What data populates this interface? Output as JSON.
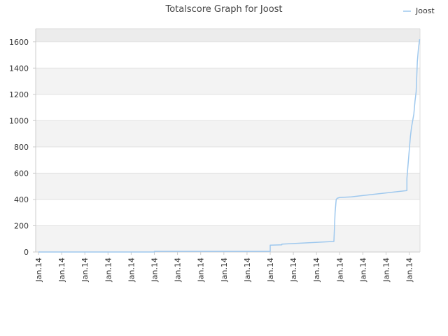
{
  "chart_data": {
    "type": "line",
    "title": "Totalscore Graph for Joost",
    "xlabel": "",
    "ylabel": "",
    "ylim": [
      0,
      1700
    ],
    "yticks": [
      0,
      200,
      400,
      600,
      800,
      1000,
      1200,
      1400,
      1600
    ],
    "xtick_labels": [
      "Jan.14",
      "Jan.14",
      "Jan.14",
      "Jan.14",
      "Jan.14",
      "Jan.14",
      "Jan.14",
      "Jan.14",
      "Jan.14",
      "Jan.14",
      "Jan.14",
      "Jan.14",
      "Jan.14",
      "Jan.14",
      "Jan.14",
      "Jan.14",
      "Jan.14"
    ],
    "legend": {
      "position": "top-right",
      "entries": [
        "Joost"
      ]
    },
    "grid": true,
    "colors": {
      "line": "#9ec8ee",
      "band": "#f3f3f3",
      "grid": "#e2e2e2",
      "axis": "#cccccc"
    },
    "series": [
      {
        "name": "Joost",
        "x": [
          0,
          5.0,
          5.0,
          10.0,
          10.0,
          10.5,
          10.5,
          12.7,
          12.75,
          12.8,
          12.85,
          12.9,
          13.0,
          13.5,
          15.9,
          15.9,
          16.05,
          16.1,
          16.2,
          16.25,
          16.3,
          16.35,
          16.4,
          16.45
        ],
        "values": [
          0,
          0,
          5,
          5,
          52,
          55,
          60,
          80,
          80,
          300,
          400,
          410,
          415,
          420,
          468,
          560,
          880,
          950,
          1050,
          1150,
          1220,
          1450,
          1550,
          1620
        ]
      }
    ]
  }
}
